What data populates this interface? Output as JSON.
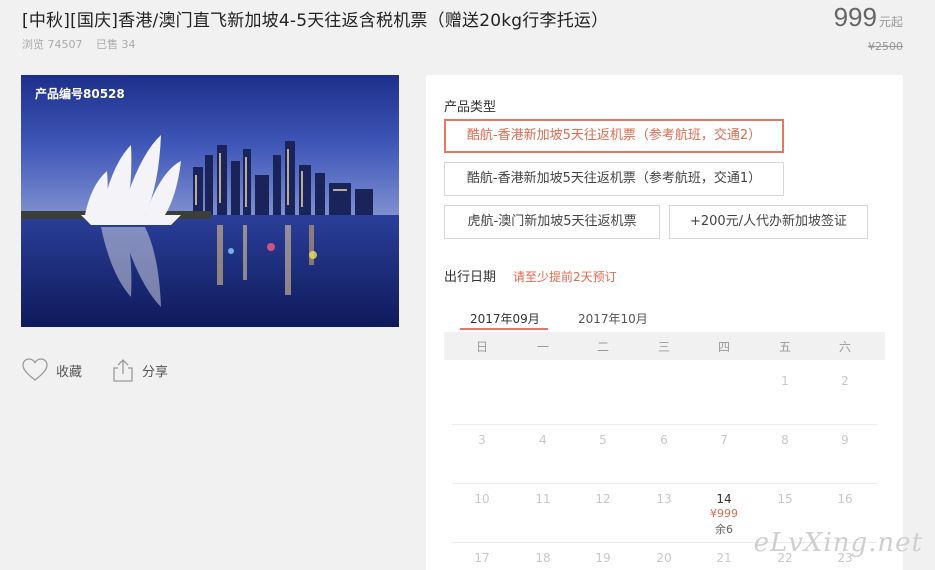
{
  "title": "[中秋][国庆]香港/澳门直飞新加坡4-5天往返含税机票（赠送20kg行李托运）",
  "meta": {
    "views": "浏览 74507",
    "sold": "已售 34"
  },
  "price": {
    "value": "999",
    "unit": "元起",
    "original": "¥2500"
  },
  "photo": {
    "code": "产品编号80528"
  },
  "actions": {
    "favorite": "收藏",
    "share": "分享"
  },
  "product_type": {
    "label": "产品类型",
    "options": [
      {
        "label": "酷航-香港新加坡5天往返机票（参考航班，交通2）",
        "selected": true
      },
      {
        "label": "酷航-香港新加坡5天往返机票（参考航班，交通1）",
        "selected": false
      },
      {
        "label": "虎航-澳门新加坡5天往返机票",
        "selected": false
      },
      {
        "label": "+200元/人代办新加坡签证",
        "selected": false
      }
    ]
  },
  "travel_date": {
    "label": "出行日期",
    "hint": "请至少提前2天预订"
  },
  "calendar": {
    "months": [
      "2017年09月",
      "2017年10月"
    ],
    "active_month": 0,
    "weekdays": [
      "日",
      "一",
      "二",
      "三",
      "四",
      "五",
      "六"
    ],
    "rows": [
      [
        "",
        "",
        "",
        "",
        "",
        "1",
        "2"
      ],
      [
        "3",
        "4",
        "5",
        "6",
        "7",
        "8",
        "9"
      ],
      [
        "10",
        "11",
        "12",
        "13",
        "14",
        "15",
        "16"
      ],
      [
        "17",
        "18",
        "19",
        "20",
        "21",
        "22",
        "23"
      ]
    ],
    "available": {
      "day": "14",
      "price": "¥999",
      "remaining": "余6"
    }
  },
  "watermark": "eLvXing.net",
  "colors": {
    "accent": "#e8755f",
    "background": "#f1f1f1"
  }
}
